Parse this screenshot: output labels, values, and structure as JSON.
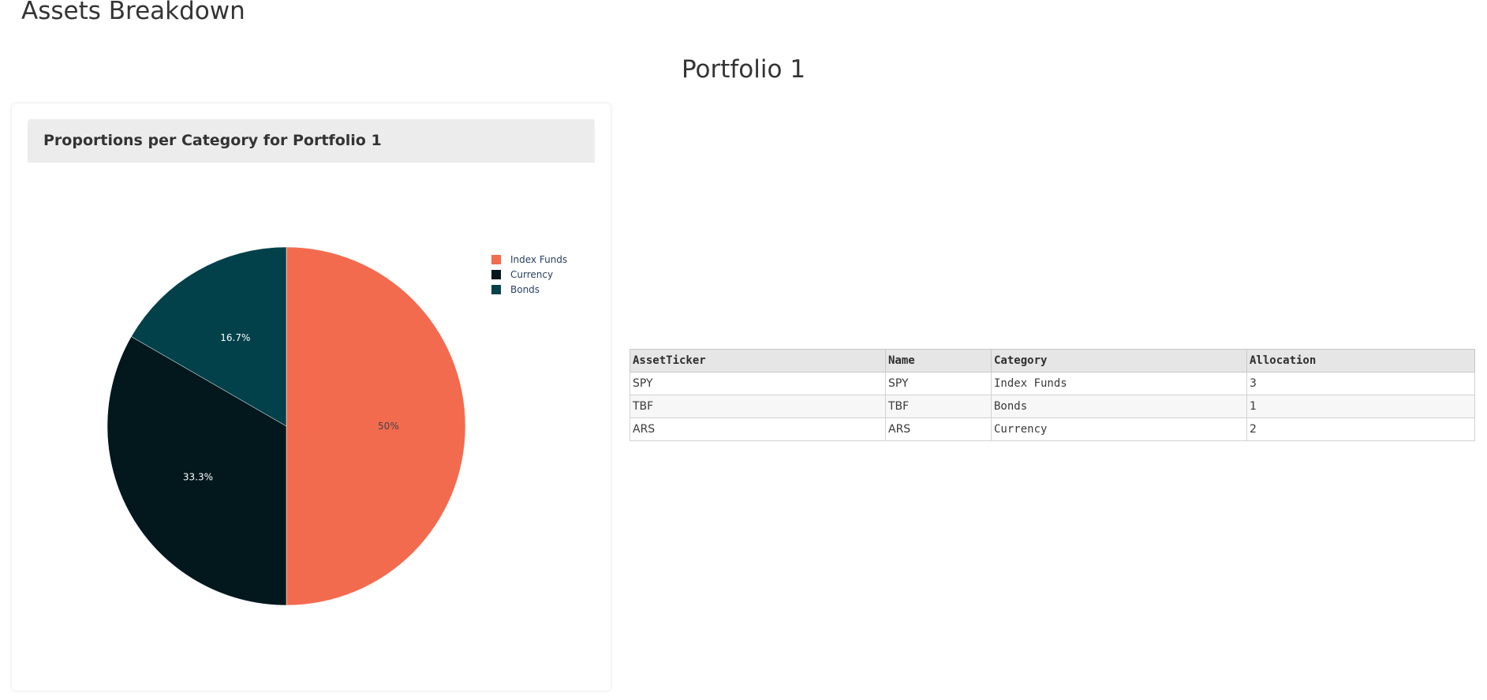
{
  "page": {
    "title": "Assets Breakdown",
    "portfolio_title": "Portfolio 1"
  },
  "card": {
    "header_title": "Proportions per Category for Portfolio 1"
  },
  "colors": {
    "index_funds": "#f26b4f",
    "currency": "#03181d",
    "bonds": "#02414a"
  },
  "chart_data": {
    "type": "pie",
    "title": "",
    "categories": [
      "Index Funds",
      "Currency",
      "Bonds"
    ],
    "values": [
      3,
      2,
      1
    ],
    "percent_labels": [
      "50%",
      "33.3%",
      "16.7%"
    ],
    "colors": [
      "#f26b4f",
      "#03181d",
      "#02414a"
    ],
    "legend_position": "right"
  },
  "table": {
    "columns": [
      "AssetTicker",
      "Name",
      "Category",
      "Allocation"
    ],
    "rows": [
      [
        "SPY",
        "SPY",
        "Index Funds",
        "3"
      ],
      [
        "TBF",
        "TBF",
        "Bonds",
        "1"
      ],
      [
        "ARS",
        "ARS",
        "Currency",
        "2"
      ]
    ]
  }
}
